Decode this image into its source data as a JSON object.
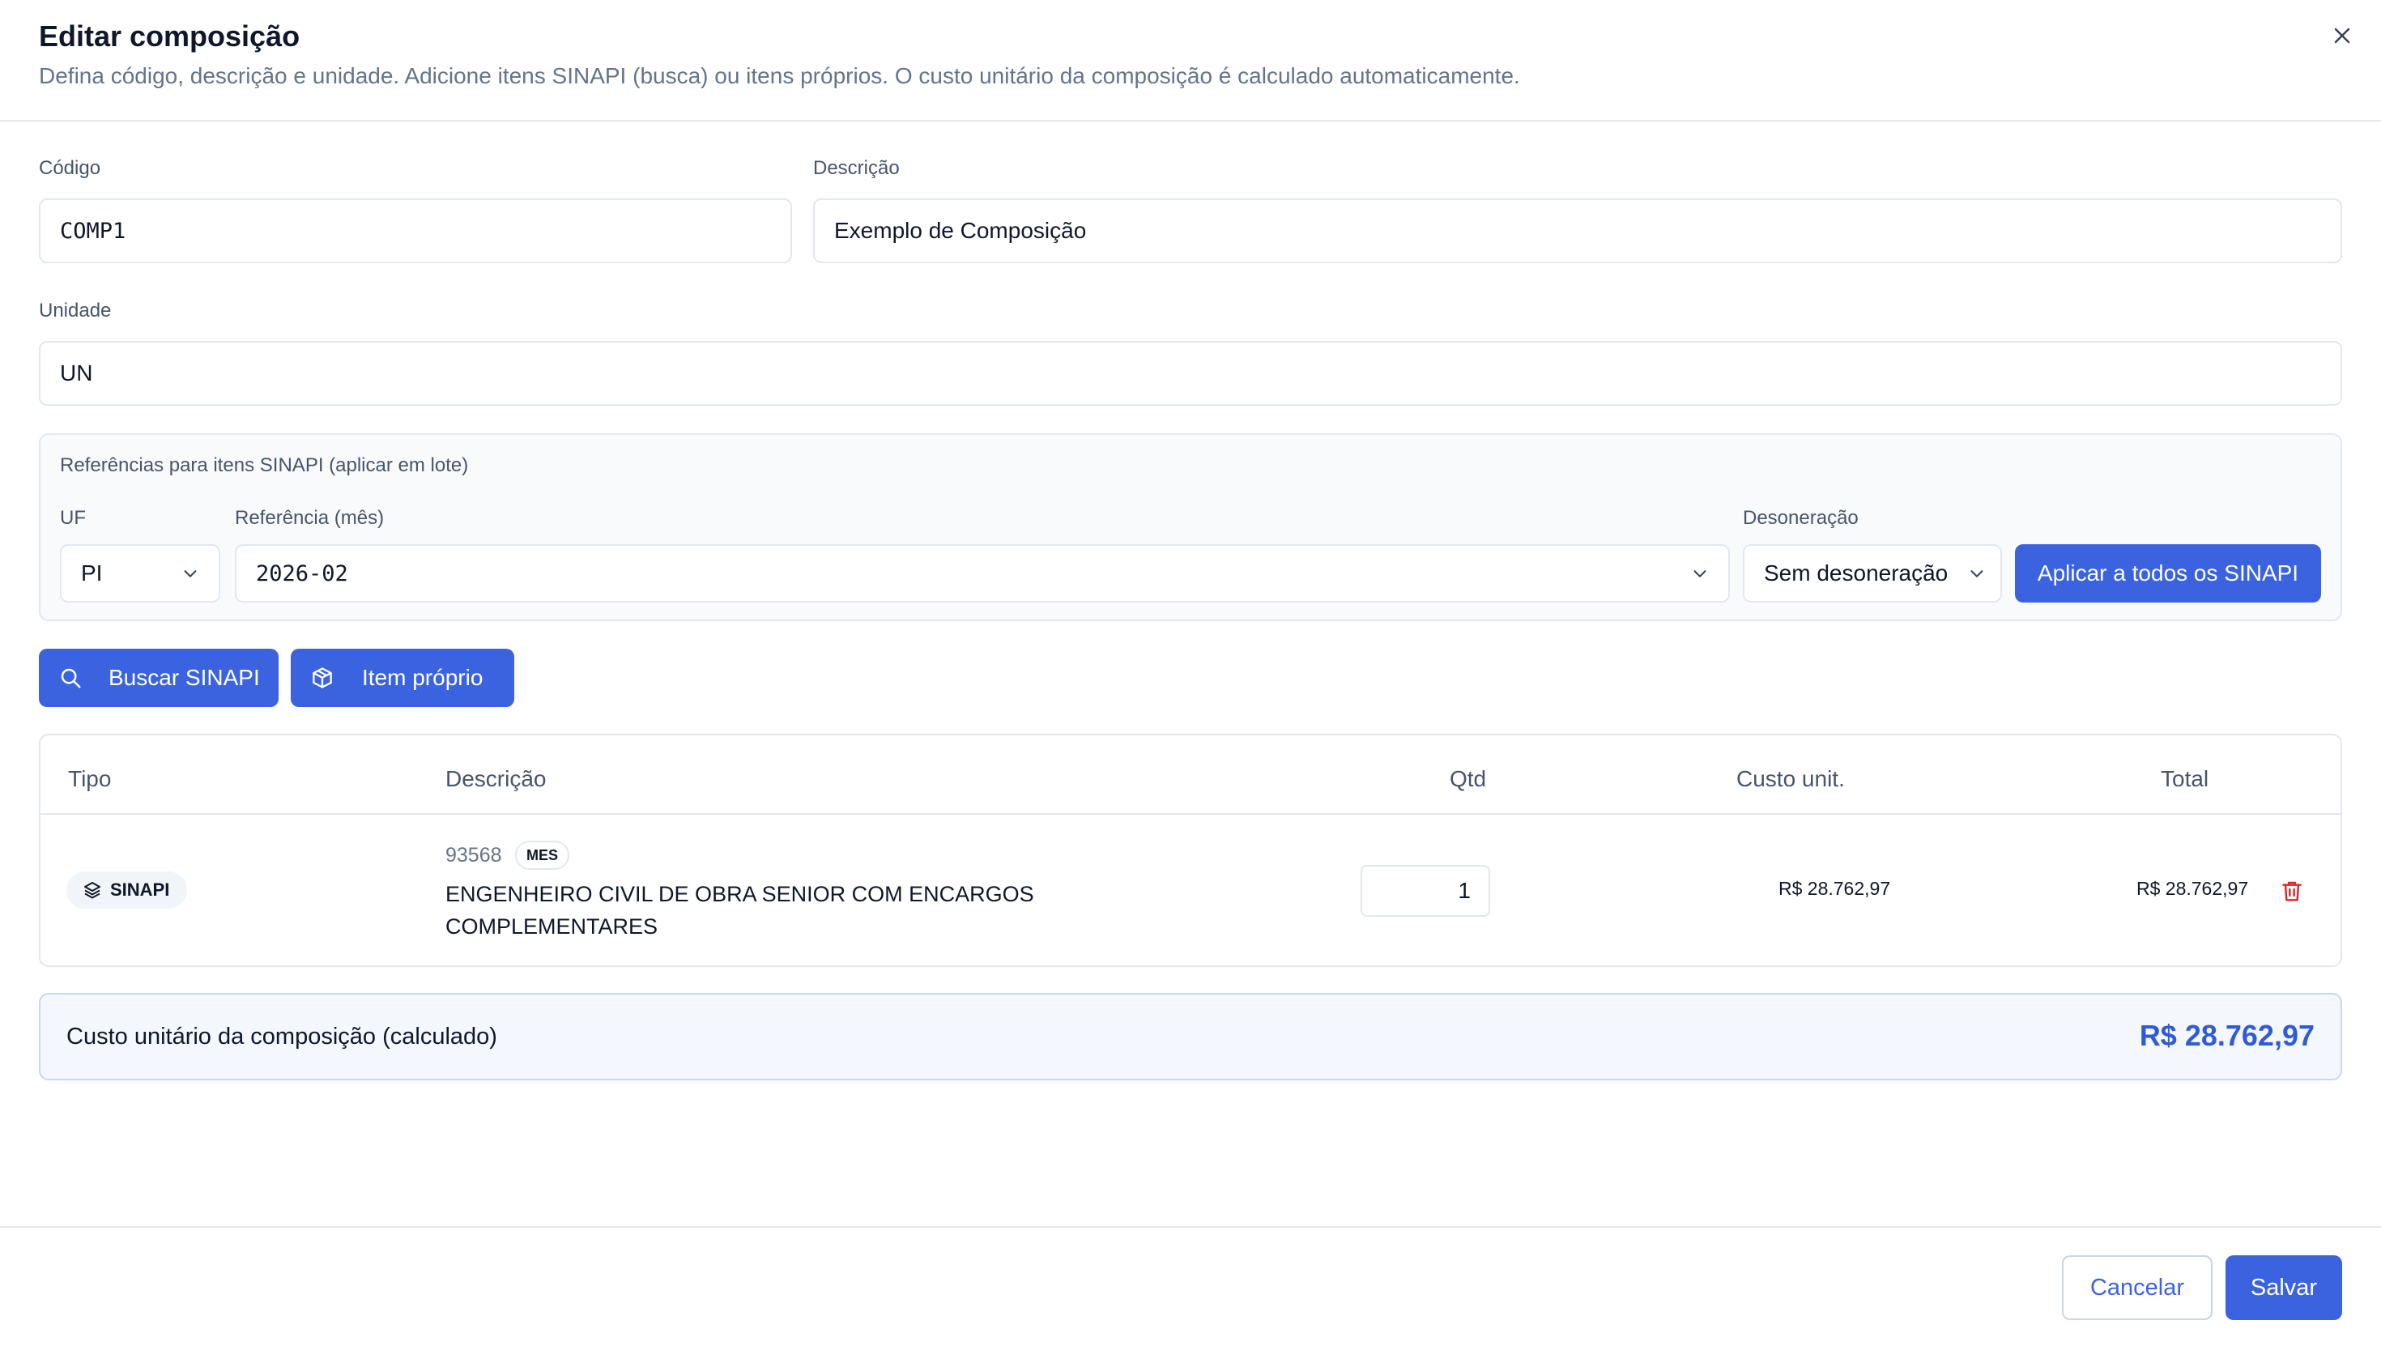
{
  "modal": {
    "title": "Editar composição",
    "subtitle": "Defina código, descrição e unidade. Adicione itens SINAPI (busca) ou itens próprios. O custo unitário da composição é calculado automaticamente."
  },
  "form": {
    "codigo_label": "Código",
    "codigo_value": "COMP1",
    "descricao_label": "Descrição",
    "descricao_value": "Exemplo de Composição",
    "unidade_label": "Unidade",
    "unidade_value": "UN"
  },
  "references": {
    "title": "Referências para itens SINAPI (aplicar em lote)",
    "uf_label": "UF",
    "uf_value": "PI",
    "ref_label": "Referência (mês)",
    "ref_value": "2026-02",
    "deson_label": "Desoneração",
    "deson_value": "Sem desoneração",
    "apply_label": "Aplicar a todos os SINAPI"
  },
  "actions": {
    "search_sinapi": "Buscar SINAPI",
    "own_item": "Item próprio"
  },
  "table": {
    "headers": {
      "tipo": "Tipo",
      "descricao": "Descrição",
      "qtd": "Qtd",
      "custo": "Custo unit.",
      "total": "Total"
    },
    "rows": [
      {
        "tipo": "SINAPI",
        "code": "93568",
        "unit": "MES",
        "description": "ENGENHEIRO CIVIL DE OBRA SENIOR COM ENCARGOS COMPLEMENTARES",
        "qty": "1",
        "unit_cost": "R$ 28.762,97",
        "total": "R$ 28.762,97"
      }
    ]
  },
  "summary": {
    "label": "Custo unitário da composição (calculado)",
    "value": "R$ 28.762,97"
  },
  "footer": {
    "cancel": "Cancelar",
    "save": "Salvar"
  },
  "colors": {
    "primary": "#3b63e0",
    "danger": "#dc2626",
    "muted": "#64748b"
  }
}
